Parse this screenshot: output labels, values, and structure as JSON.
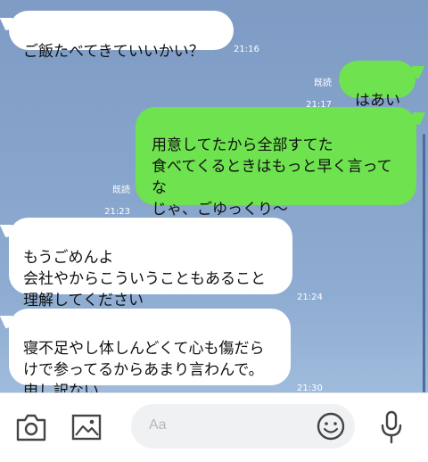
{
  "messages": [
    {
      "side": "in",
      "text": "ご飯たべてきていいかい？",
      "time": "21:16"
    },
    {
      "side": "out",
      "text": "はあい",
      "read": "既読",
      "time": "21:17"
    },
    {
      "side": "out",
      "text": "用意してたから全部すてた\n食べてくるときはもっと早く言って\nな\nじゃ、ごゆっくり〜",
      "read": "既読",
      "time": "21:23"
    },
    {
      "side": "in",
      "text": "もうごめんよ\n会社やからこういうこともあること\n理解してください",
      "time": "21:24"
    },
    {
      "side": "in",
      "text": "寝不足やし体しんどくて心も傷だら\nけで参ってるからあまり言わんで。\n申し訳ない",
      "time": "21:30"
    }
  ],
  "input": {
    "placeholder": "Aa"
  },
  "icons": [
    "camera-icon",
    "image-icon",
    "emoji-icon",
    "microphone-icon"
  ],
  "colors": {
    "incoming_bubble": "#ffffff",
    "outgoing_bubble": "#6ee24f",
    "chat_bg": "#86a4cb"
  }
}
